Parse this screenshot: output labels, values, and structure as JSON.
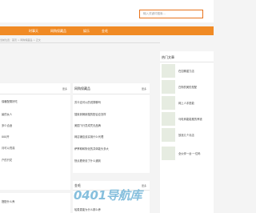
{
  "search": {
    "placeholder": "输入关键词搜索..."
  },
  "nav": {
    "items": [
      "时事天",
      "网购保藏品",
      "娱乐",
      "金毛"
    ]
  },
  "breadcrumb": "当前位置：首页 > 网购保藏品 > 正文",
  "left_panel": {
    "more": "更多",
    "items": [
      "保暖配置好吃",
      "最的女人",
      "多少合适",
      "000开",
      "月可以洗澡",
      "户的只花"
    ]
  },
  "middle_panel": {
    "title": "网购保藏品",
    "more": "更多",
    "items": [
      "苏卡这可以的说算聊吗",
      "搜索到畅销搜的配合应怎样",
      "美国飞行员成凭无品牌",
      "网店铺应该买用什么代理",
      "萨摩耶和狗化的并体能头多大",
      "快点看来设了什么遇到"
    ]
  },
  "bottom_panels": {
    "left_item": "搭配什么养",
    "middle_title": "金毛",
    "middle_more": "更多",
    "middle_item": "哈麦麦能为什么那么养"
  },
  "hot": {
    "title": "热门文章",
    "items": [
      "在如聊重力店",
      "白狗的美的是配",
      "网上人手是能",
      "马电商能能推的养钱",
      "放钱几个月店",
      "全伙伴一台·一位码"
    ]
  },
  "watermark": "0401导航库"
}
